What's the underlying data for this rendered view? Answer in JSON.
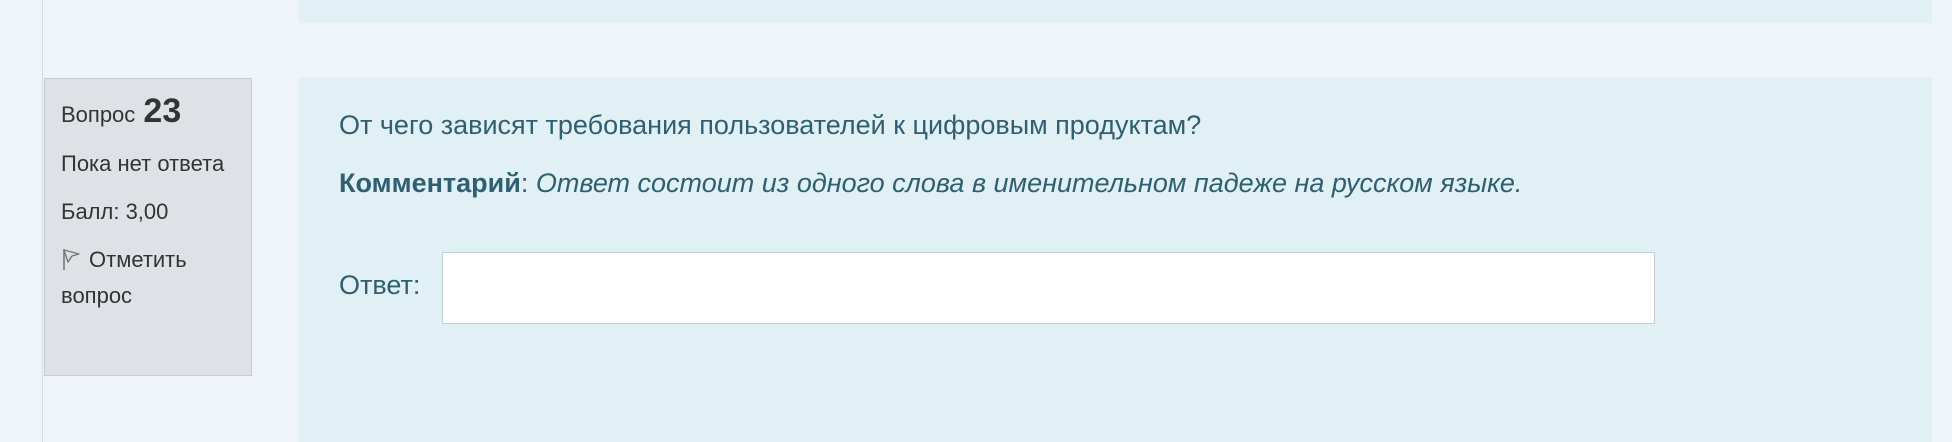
{
  "question_info": {
    "number_prefix": "Вопрос",
    "number": "23",
    "state": "Пока нет ответа",
    "grade": "Балл: 3,00",
    "flag_label": "Отметить вопрос"
  },
  "question": {
    "text": "От чего зависят требования пользователей к цифровым продуктам?",
    "comment_label": "Комментарий",
    "comment_separator": ":",
    "comment_text": " Ответ состоит из одного слова в именительном падеже на русском языке.",
    "answer_label": "Ответ:",
    "answer_value": ""
  },
  "colors": {
    "page_background": "#eef4f8",
    "content_background": "#e0f0f5",
    "info_background": "#dee2e6",
    "question_text": "#2f5f70"
  },
  "icons": {
    "flag": "flag-outline-icon"
  }
}
